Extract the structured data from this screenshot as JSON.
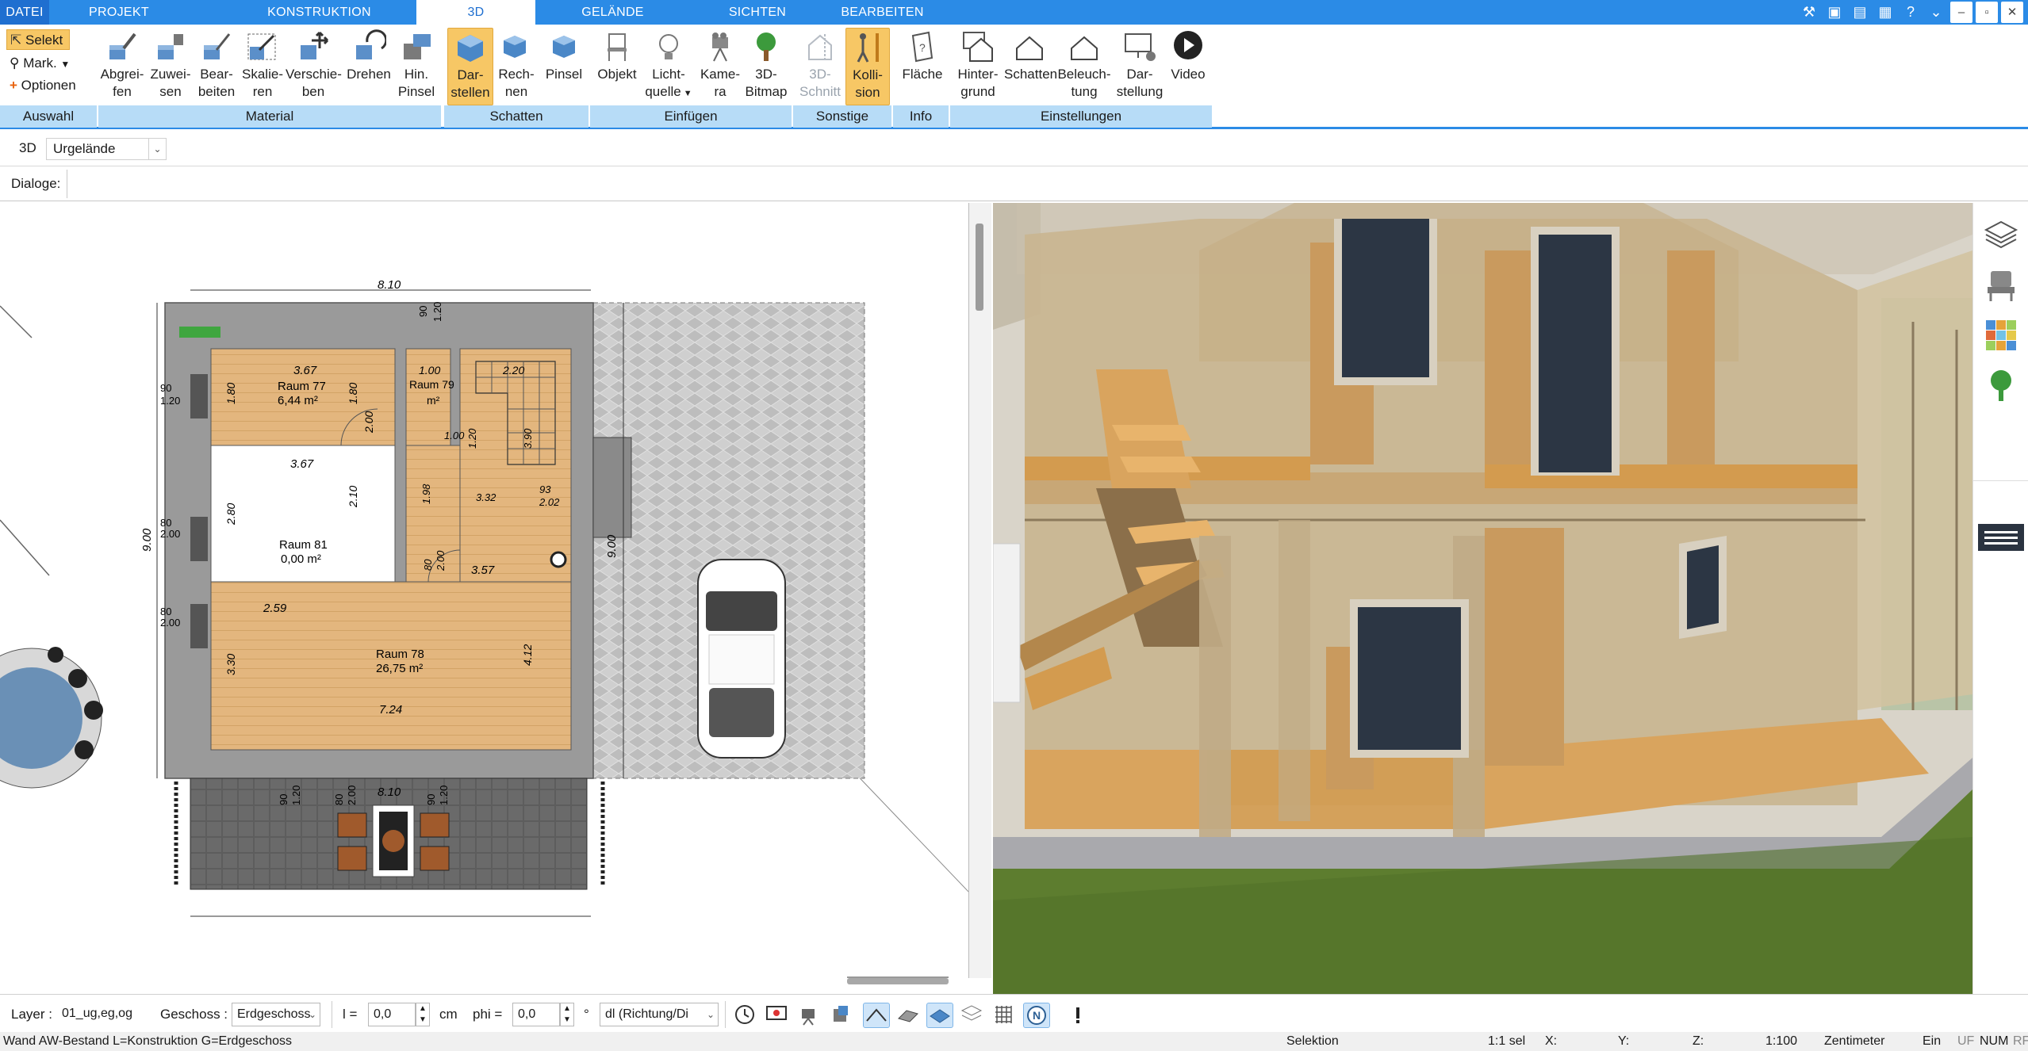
{
  "tabs": [
    "DATEI",
    "PROJEKT",
    "KONSTRUKTION",
    "3D",
    "GELÄNDE",
    "SICHTEN",
    "BEARBEITEN"
  ],
  "active_tab": "3D",
  "ribbon": {
    "auswahl": {
      "selekt": "Selekt",
      "mark": "Mark.",
      "optionen": "Optionen",
      "group": "Auswahl"
    },
    "material": {
      "group": "Material",
      "buttons": [
        {
          "l1": "Abgrei-",
          "l2": "fen"
        },
        {
          "l1": "Zuwei-",
          "l2": "sen"
        },
        {
          "l1": "Bear-",
          "l2": "beiten"
        },
        {
          "l1": "Skalie-",
          "l2": "ren"
        },
        {
          "l1": "Verschie-",
          "l2": "ben"
        },
        {
          "l1": "Drehen",
          "l2": ""
        },
        {
          "l1": "Hin.",
          "l2": "Pinsel"
        }
      ]
    },
    "schatten": {
      "group": "Schatten",
      "buttons": [
        {
          "l1": "Dar-",
          "l2": "stellen"
        },
        {
          "l1": "Rech-",
          "l2": "nen"
        },
        {
          "l1": "Pinsel",
          "l2": ""
        }
      ]
    },
    "einfuegen": {
      "group": "Einfügen",
      "buttons": [
        {
          "l1": "Objekt",
          "l2": ""
        },
        {
          "l1": "Licht-",
          "l2": "quelle"
        },
        {
          "l1": "Kame-",
          "l2": "ra"
        },
        {
          "l1": "3D-",
          "l2": "Bitmap"
        }
      ]
    },
    "sonstige": {
      "group": "Sonstige",
      "buttons": [
        {
          "l1": "3D-",
          "l2": "Schnitt"
        },
        {
          "l1": "Kolli-",
          "l2": "sion"
        }
      ]
    },
    "info": {
      "group": "Info",
      "buttons": [
        {
          "l1": "Fläche",
          "l2": ""
        }
      ]
    },
    "einstellungen": {
      "group": "Einstellungen",
      "buttons": [
        {
          "l1": "Hinter-",
          "l2": "grund"
        },
        {
          "l1": "Schatten",
          "l2": ""
        },
        {
          "l1": "Beleuch-",
          "l2": "tung"
        },
        {
          "l1": "Dar-",
          "l2": "stellung"
        },
        {
          "l1": "Video",
          "l2": ""
        }
      ]
    }
  },
  "viewbar": {
    "mode": "3D",
    "terrain": "Urgelände"
  },
  "dialogbar": {
    "label": "Dialoge:"
  },
  "plan": {
    "dims": {
      "top_width": "8.10",
      "left_height": "9.00",
      "right_height": "9.00",
      "bottom_width": "8.10",
      "r77_w": "3.67",
      "r77_h": "1.80",
      "r77_h2": "1.80",
      "r77_door": "2.00",
      "r79_w": "1.00",
      "stair_w": "2.20",
      "r81_w": "3.67",
      "r81_h": "2.80",
      "r81_h2": "2.10",
      "r78_top": "3.57",
      "r78_w": "2.59",
      "r78_h": "3.30",
      "r78_h2": "4.12",
      "r78_bottom": "7.24",
      "mid_a": "1.98",
      "mid_b": "3.32",
      "mid_c": "2.02",
      "mid_d": "93",
      "mid_e": "2.00",
      "mid_f": "80",
      "stair_a": "1.00",
      "stair_b": "3.90",
      "stair_c": "1.20",
      "w_90": "90",
      "w_120": "1.20",
      "w_80": "80",
      "w_200": "2.00",
      "w_200b": "2.00",
      "w_80b": "80",
      "top_90": "90",
      "top_120": "1.20",
      "b_90": "90",
      "b_120": "1.20",
      "b_80": "80",
      "b_200": "2.00",
      "b_90b": "90",
      "b_120b": "1.20"
    },
    "rooms": [
      {
        "name": "Raum 77",
        "area": "6,44 m²"
      },
      {
        "name": "Raum 79",
        "area": "m²"
      },
      {
        "name": "Raum 81",
        "area": "0,00 m²"
      },
      {
        "name": "Raum 78",
        "area": "26,75 m²"
      }
    ]
  },
  "inputbar": {
    "layer_label": "Layer :",
    "layer_value": "01_ug,eg,og",
    "geschoss_label": "Geschoss :",
    "geschoss_value": "Erdgeschoss",
    "l_label": "l =",
    "l_value": "0,0",
    "l_unit": "cm",
    "phi_label": "phi =",
    "phi_value": "0,0",
    "phi_unit": "°",
    "dl_value": "dl (Richtung/Di"
  },
  "statusbar": {
    "left": "Wand AW-Bestand L=Konstruktion G=Erdgeschoss",
    "mode": "Selektion",
    "sel": "1:1 sel",
    "x": "X:",
    "y": "Y:",
    "z": "Z:",
    "scale": "1:100",
    "unit": "Zentimeter",
    "ein": "Ein",
    "uf": "UF",
    "num": "NUM",
    "rf": "RF"
  },
  "colors": {
    "accent": "#2b8be6",
    "group_bg": "#b7dcf7",
    "active_btn": "#f7c765",
    "floor": "#e2b47c",
    "paving": "#c9c9c9"
  }
}
